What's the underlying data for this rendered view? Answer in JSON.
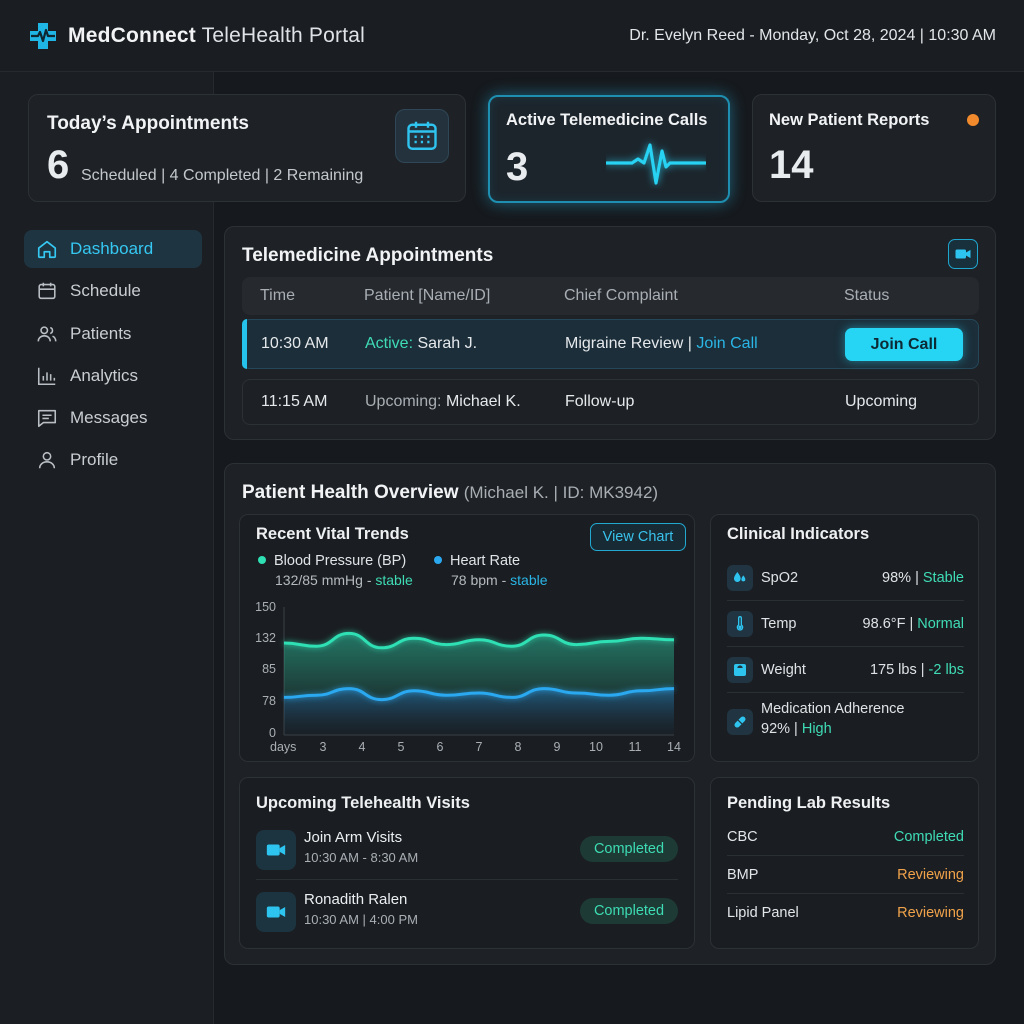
{
  "header": {
    "brand_bold": "MedConnect",
    "brand_rest": "TeleHealth Portal",
    "user_datetime": "Dr. Evelyn Reed - Monday, Oct 28, 2024 | 10:30 AM"
  },
  "colors": {
    "accent": "#26d4f4",
    "green": "#3fdcb6",
    "orange": "#f0a24a",
    "background": "#16191d"
  },
  "sidebar": {
    "items": [
      {
        "label": "Dashboard",
        "icon": "home-icon",
        "active": true
      },
      {
        "label": "Schedule",
        "icon": "calendar-icon"
      },
      {
        "label": "Patients",
        "icon": "users-icon"
      },
      {
        "label": "Analytics",
        "icon": "bar-chart-icon"
      },
      {
        "label": "Messages",
        "icon": "message-icon"
      },
      {
        "label": "Profile",
        "icon": "user-icon"
      }
    ]
  },
  "stats": {
    "appointments": {
      "title": "Today’s Appointments",
      "count": "6",
      "detail": "Scheduled | 4 Completed | 2 Remaining"
    },
    "calls": {
      "title": "Active Telemedicine Calls",
      "count": "3"
    },
    "reports": {
      "title": "New Patient Reports",
      "count": "14"
    }
  },
  "telemedicine": {
    "title": "Telemedicine Appointments",
    "columns": [
      "Time",
      "Patient [Name/ID]",
      "Chief Complaint",
      "Status"
    ],
    "rows": [
      {
        "time": "10:30 AM",
        "patient_prefix": "Active:",
        "patient": "Sarah J.",
        "complaint": "Migraine Review",
        "complaint_link": "Join Call",
        "action": "Join Call"
      },
      {
        "time": "11:15 AM",
        "patient_prefix": "Upcoming:",
        "patient": "Michael K.",
        "complaint": "Follow-up",
        "status": "Upcoming"
      }
    ]
  },
  "overview": {
    "title": "Patient Health Overview",
    "patient": "(Michael K. | ID: MK3942)",
    "vitals": {
      "title": "Recent Vital Trends",
      "button": "View Chart",
      "legend": [
        {
          "name": "Blood Pressure (BP)",
          "value": "132/85 mmHg -",
          "trend": "stable",
          "color": "#2ee0b4"
        },
        {
          "name": "Heart Rate",
          "value": "78 bpm -",
          "trend": "stable",
          "color": "#2aa8f0"
        }
      ]
    },
    "clinical": {
      "title": "Clinical Indicators",
      "items": [
        {
          "name": "SpO2",
          "value": "98% |",
          "status": "Stable",
          "icon": "droplet-icon"
        },
        {
          "name": "Temp",
          "value": "98.6°F |",
          "status": "Normal",
          "icon": "thermometer-icon"
        },
        {
          "name": "Weight",
          "value": "175 lbs |",
          "status": "-2 lbs",
          "icon": "scale-icon"
        },
        {
          "name": "Medication Adherence",
          "value": "92% |",
          "status": "High",
          "icon": "pill-icon"
        }
      ]
    },
    "upcoming": {
      "title": "Upcoming Telehealth Visits",
      "visits": [
        {
          "name": "Join Arm Visits",
          "time": "10:30 AM - 8:30 AM",
          "status": "Completed"
        },
        {
          "name": "Ronadith Ralen",
          "time": "10:30 AM | 4:00 PM",
          "status": "Completed"
        }
      ]
    },
    "labs": {
      "title": "Pending Lab Results",
      "items": [
        {
          "name": "CBC",
          "status": "Completed"
        },
        {
          "name": "BMP",
          "status": "Reviewing"
        },
        {
          "name": "Lipid Panel",
          "status": "Reviewing"
        }
      ]
    }
  },
  "chart_data": {
    "type": "area",
    "title": "Recent Vital Trends",
    "xlabel": "days",
    "x": [
      2,
      3,
      4,
      5,
      6,
      7,
      8,
      9,
      10,
      11,
      12,
      13,
      14
    ],
    "x_ticks": [
      "3",
      "4",
      "5",
      "6",
      "7",
      "8",
      "9",
      "10",
      "11",
      "14"
    ],
    "y_ticks": [
      "150",
      "132",
      "85",
      "78",
      "0"
    ],
    "series": [
      {
        "name": "Blood Pressure (BP)",
        "values": [
          132,
          130,
          138,
          129,
          135,
          131,
          134,
          130,
          137,
          131,
          133,
          135,
          134
        ],
        "color": "#2ee0b4"
      },
      {
        "name": "Heart Rate",
        "values": [
          78,
          79,
          82,
          77,
          81,
          79,
          80,
          78,
          82,
          80,
          79,
          81,
          82
        ],
        "color": "#2aa8f0"
      }
    ],
    "grid": false
  }
}
